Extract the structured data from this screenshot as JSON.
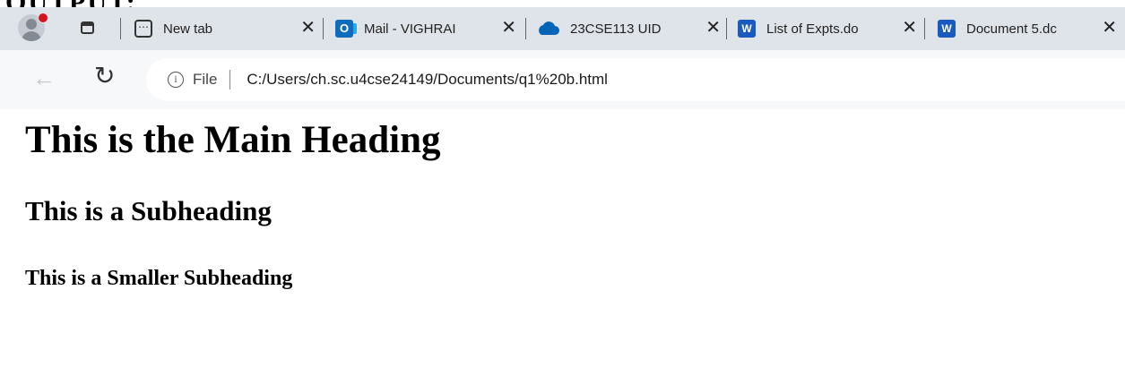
{
  "document_label": "OUTPUT:",
  "browser": {
    "tabs": [
      {
        "title": "New tab",
        "icon": "new-tab-icon"
      },
      {
        "title": "Mail - VIGHRAI",
        "icon": "outlook-icon",
        "icon_text": "O"
      },
      {
        "title": "23CSE113 UID",
        "icon": "onedrive-cloud-icon"
      },
      {
        "title": "List of Expts.do",
        "icon": "word-icon",
        "icon_text": "W"
      },
      {
        "title": "Document 5.dc",
        "icon": "word-icon",
        "icon_text": "W"
      }
    ],
    "address_bar": {
      "site_label": "File",
      "url": "C:/Users/ch.sc.u4cse24149/Documents/q1%20b.html"
    }
  },
  "page": {
    "h1": "This is the Main Heading",
    "h2": "This is a Subheading",
    "h3": "This is a Smaller Subheading"
  },
  "colors": {
    "tab_strip": "#dfe3ea",
    "toolbar": "#f7f8fa",
    "outlook_blue": "#0f6cbd",
    "word_blue": "#185abd",
    "onedrive_blue": "#0364b8",
    "profile_badge": "#d3131d"
  }
}
